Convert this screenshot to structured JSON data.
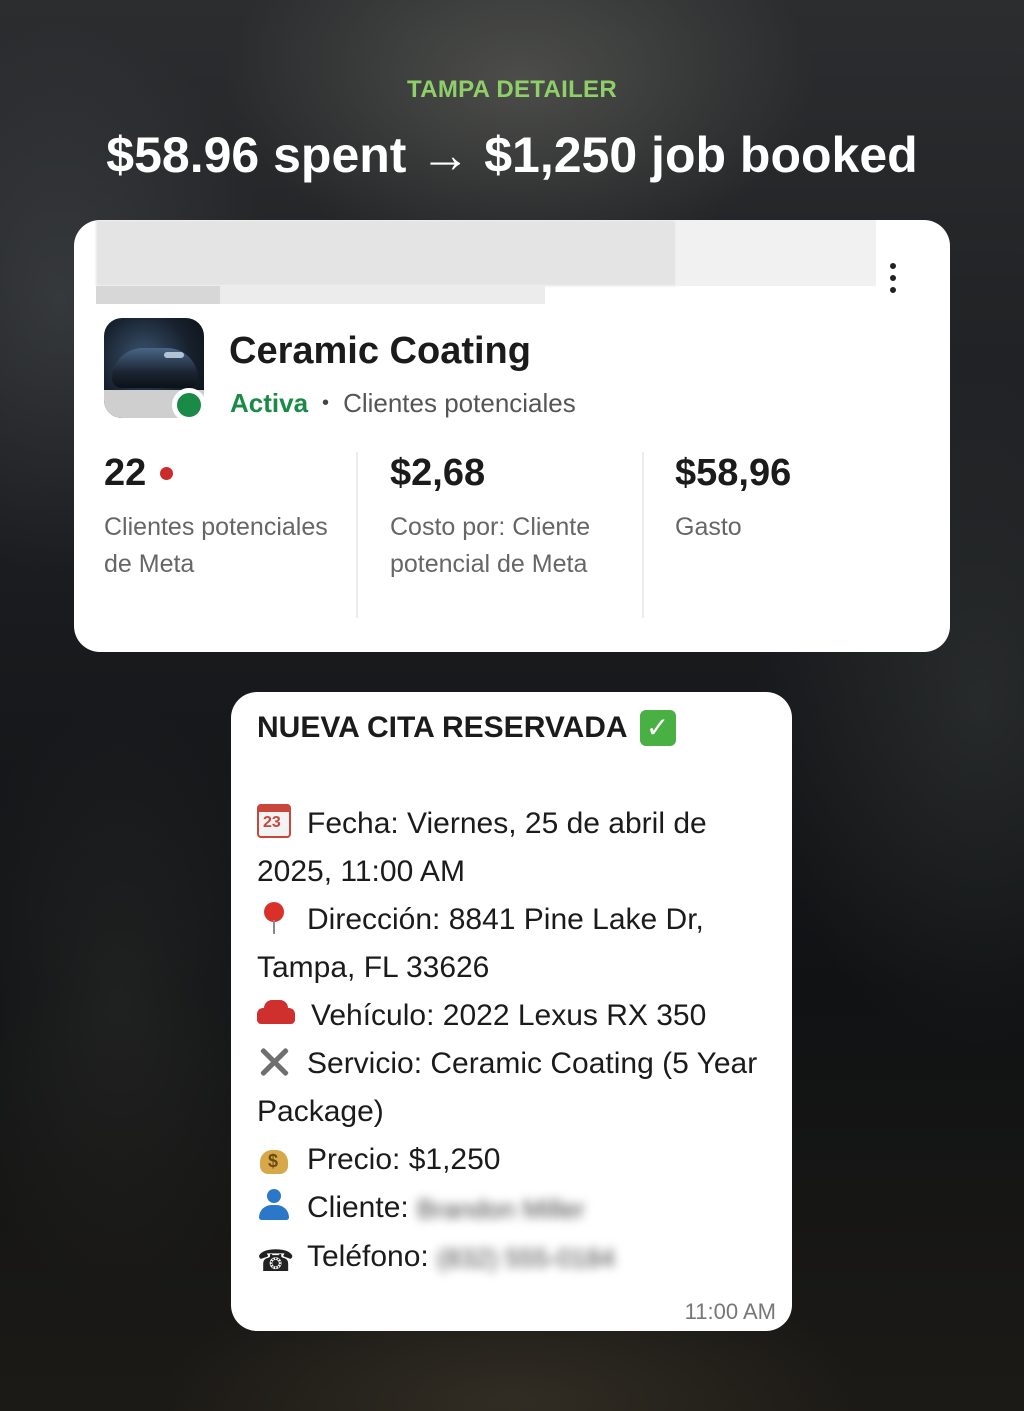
{
  "header": {
    "eyebrow": "TAMPA DETAILER",
    "headline": "$58.96 spent → $1,250 job booked"
  },
  "ad_card": {
    "title": "Ceramic Coating",
    "status": "Activa",
    "objective": "Clientes potenciales",
    "metrics": [
      {
        "value": "22",
        "label": "Clientes potenciales de Meta"
      },
      {
        "value": "$2,68",
        "label": "Costo por: Cliente potencial de Meta"
      },
      {
        "value": "$58,96",
        "label": "Gasto"
      }
    ],
    "colors": {
      "status_green": "#1a8a47",
      "alert_red": "#cc2b2b"
    }
  },
  "booking_message": {
    "title": "NUEVA CITA RESERVADA",
    "lines": {
      "fecha": "Fecha: Viernes, 25 de abril de 2025, 11:00 AM",
      "direccion": "Dirección: 8841 Pine Lake Dr, Tampa, FL 33626",
      "vehiculo": "Vehículo: 2022 Lexus RX 350",
      "servicio": "Servicio: Ceramic Coating (5 Year Package)",
      "precio": "Precio: $1,250",
      "cliente_label": "Cliente:",
      "cliente_value": "Brandon Miller",
      "telefono_label": "Teléfono:",
      "telefono_value": "(832) 555-0184"
    },
    "time": "11:00 AM"
  },
  "icons": [
    "more-vert-icon",
    "check-mark-icon",
    "calendar-icon",
    "location-pin-icon",
    "car-icon",
    "tools-icon",
    "money-bag-icon",
    "person-icon",
    "phone-icon"
  ]
}
